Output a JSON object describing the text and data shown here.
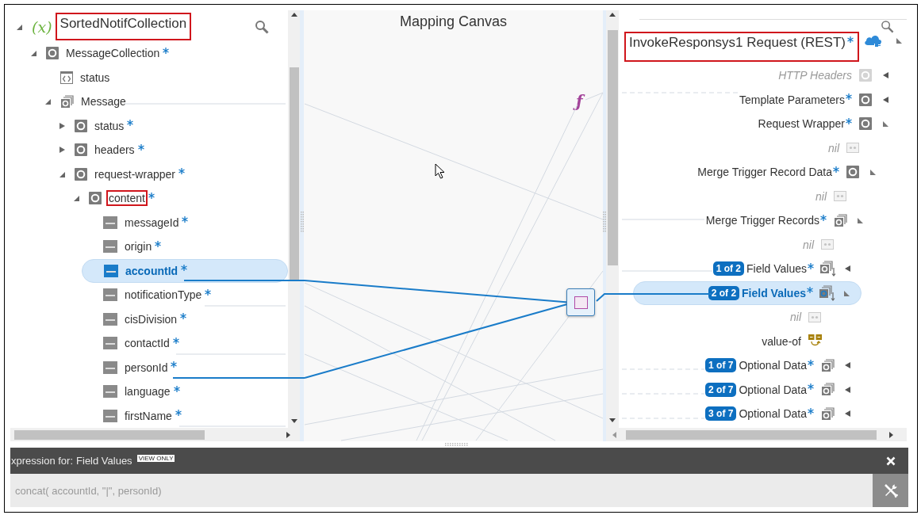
{
  "source_tree": [
    {
      "kind": "variable",
      "symbol": "(x)",
      "label": "SortedNotifCollection",
      "required": false,
      "highlighted": true,
      "selected": false,
      "expanded": true,
      "children": [
        {
          "kind": "object",
          "label": "MessageCollection",
          "required": true,
          "highlighted": false,
          "selected": false,
          "expanded": true,
          "children": [
            {
              "kind": "attribute",
              "label": "status",
              "required": false,
              "highlighted": false,
              "selected": false
            },
            {
              "kind": "collection",
              "label": "Message",
              "required": false,
              "highlighted": false,
              "selected": false,
              "expanded": true,
              "children": [
                {
                  "kind": "object",
                  "label": "status",
                  "required": true,
                  "highlighted": false,
                  "selected": false,
                  "expanded": false
                },
                {
                  "kind": "object",
                  "label": "headers",
                  "required": true,
                  "highlighted": false,
                  "selected": false,
                  "expanded": false
                },
                {
                  "kind": "object",
                  "label": "request-wrapper",
                  "required": true,
                  "highlighted": false,
                  "selected": false,
                  "expanded": true,
                  "children": [
                    {
                      "kind": "object",
                      "label": "content",
                      "required": true,
                      "highlighted": true,
                      "selected": false,
                      "expanded": true,
                      "children": [
                        {
                          "kind": "string",
                          "label": "messageId",
                          "required": true,
                          "highlighted": false,
                          "selected": false
                        },
                        {
                          "kind": "string",
                          "label": "origin",
                          "required": true,
                          "highlighted": false,
                          "selected": false
                        },
                        {
                          "kind": "string",
                          "label": "accountId",
                          "required": true,
                          "highlighted": false,
                          "selected": true
                        },
                        {
                          "kind": "string",
                          "label": "notificationType",
                          "required": true,
                          "highlighted": false,
                          "selected": false
                        },
                        {
                          "kind": "string",
                          "label": "cisDivision",
                          "required": true,
                          "highlighted": false,
                          "selected": false
                        },
                        {
                          "kind": "string",
                          "label": "contactId",
                          "required": true,
                          "highlighted": false,
                          "selected": false
                        },
                        {
                          "kind": "string",
                          "label": "personId",
                          "required": true,
                          "highlighted": false,
                          "selected": false
                        },
                        {
                          "kind": "string",
                          "label": "language",
                          "required": true,
                          "highlighted": false,
                          "selected": false
                        },
                        {
                          "kind": "string",
                          "label": "firstName",
                          "required": true,
                          "highlighted": false,
                          "selected": false
                        }
                      ]
                    }
                  ]
                }
              ]
            }
          ]
        }
      ]
    }
  ],
  "canvas": {
    "title": "Mapping Canvas",
    "function_symbol": "ƒ"
  },
  "target_tree": {
    "title": "InvokeResponsys1 Request (REST)",
    "required": true,
    "highlighted": true,
    "expanded": true,
    "children": [
      {
        "kind": "object",
        "label": "HTTP Headers",
        "required": false,
        "disabled": true,
        "selected": false,
        "expanded": false
      },
      {
        "kind": "object",
        "label": "Template Parameters",
        "required": true,
        "disabled": false,
        "selected": false,
        "expanded": false
      },
      {
        "kind": "object",
        "label": "Request Wrapper",
        "required": true,
        "disabled": false,
        "selected": false,
        "expanded": true,
        "children": [
          {
            "kind": "nil",
            "label": "nil",
            "required": false,
            "disabled": false,
            "selected": false
          },
          {
            "kind": "object",
            "label": "Merge Trigger Record Data",
            "required": true,
            "disabled": false,
            "selected": false,
            "expanded": true,
            "children": [
              {
                "kind": "nil",
                "label": "nil",
                "required": false,
                "disabled": false,
                "selected": false
              },
              {
                "kind": "collection",
                "label": "Merge Trigger Records",
                "required": true,
                "disabled": false,
                "selected": false,
                "expanded": true,
                "children": [
                  {
                    "kind": "nil",
                    "label": "nil",
                    "required": false,
                    "disabled": false,
                    "selected": false
                  },
                  {
                    "kind": "sequence",
                    "badge": "1 of 2",
                    "label": "Field Values",
                    "required": true,
                    "disabled": false,
                    "selected": false,
                    "expanded": false
                  },
                  {
                    "kind": "sequence",
                    "badge": "2 of 2",
                    "label": "Field Values",
                    "required": true,
                    "disabled": false,
                    "selected": true,
                    "expanded": true,
                    "children": [
                      {
                        "kind": "nil",
                        "label": "nil",
                        "required": false,
                        "disabled": false,
                        "selected": false
                      },
                      {
                        "kind": "value-of",
                        "label": "value-of",
                        "required": false,
                        "disabled": false,
                        "selected": false
                      }
                    ]
                  },
                  {
                    "kind": "collection",
                    "badge": "1 of 7",
                    "label": "Optional Data",
                    "required": true,
                    "disabled": false,
                    "selected": false,
                    "expanded": false
                  },
                  {
                    "kind": "collection",
                    "badge": "2 of 7",
                    "label": "Optional Data",
                    "required": true,
                    "disabled": false,
                    "selected": false,
                    "expanded": false
                  },
                  {
                    "kind": "collection",
                    "badge": "3 of 7",
                    "label": "Optional Data",
                    "required": true,
                    "disabled": false,
                    "selected": false,
                    "expanded": false
                  }
                ]
              }
            ]
          }
        ]
      }
    ]
  },
  "expression": {
    "label": "xpression for:",
    "target": "Field Values",
    "badge": "VIEW ONLY",
    "value": "concat( accountId, \"|\", personId)"
  }
}
